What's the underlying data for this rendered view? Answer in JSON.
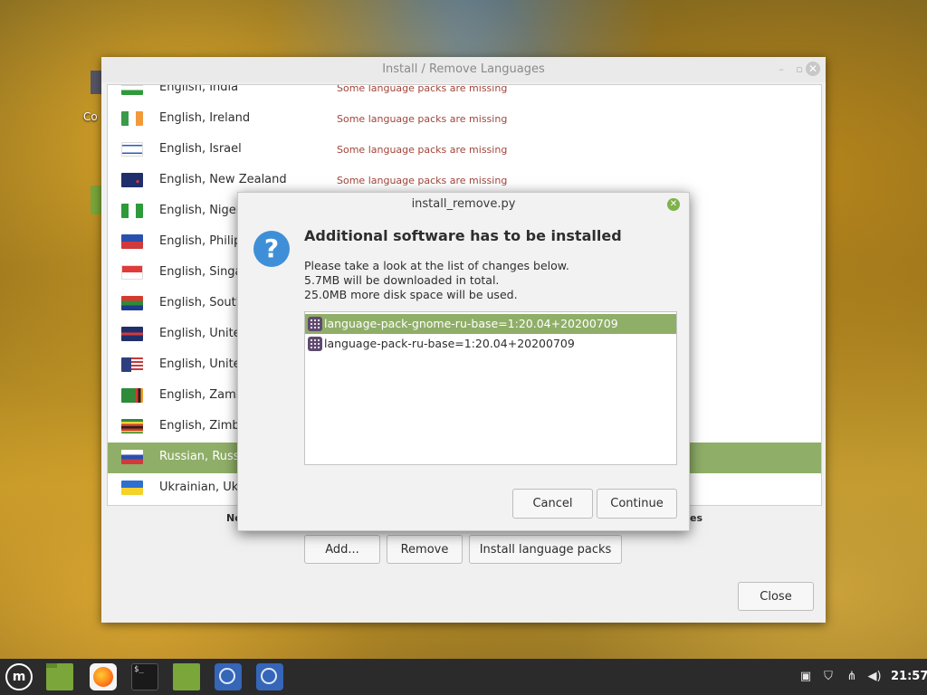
{
  "desktop": {
    "icon_label_fragment": "Co"
  },
  "main_window": {
    "title": "Install / Remove Languages",
    "languages": [
      {
        "name": "English, India",
        "status": "Some language packs are missing",
        "flag": "india-flag"
      },
      {
        "name": "English, Ireland",
        "status": "Some language packs are missing",
        "flag": "ireland-flag"
      },
      {
        "name": "English, Israel",
        "status": "Some language packs are missing",
        "flag": "israel-flag"
      },
      {
        "name": "English, New Zealand",
        "status": "Some language packs are missing",
        "flag": "new-zealand-flag"
      },
      {
        "name": "English, Nigeri",
        "status": "",
        "flag": "nigeria-flag"
      },
      {
        "name": "English, Philip",
        "status": "",
        "flag": "philippines-flag"
      },
      {
        "name": "English, Singap",
        "status": "",
        "flag": "singapore-flag"
      },
      {
        "name": "English, South",
        "status": "",
        "flag": "south-africa-flag"
      },
      {
        "name": "English, Unite",
        "status": "",
        "flag": "united-kingdom-flag"
      },
      {
        "name": "English, Unite",
        "status": "",
        "flag": "united-states-flag"
      },
      {
        "name": "English, Zamb",
        "status": "",
        "flag": "zambia-flag"
      },
      {
        "name": "English, Zimba",
        "status": "",
        "flag": "zimbabwe-flag"
      },
      {
        "name": "Russian, Russi",
        "status": "",
        "flag": "russia-flag",
        "selected": true
      },
      {
        "name": "Ukrainian, Ukr",
        "status": "",
        "flag": "ukraine-flag"
      }
    ],
    "note_left_fragment": "No",
    "note_right_fragment": "es",
    "buttons": {
      "add": "Add...",
      "remove": "Remove",
      "install": "Install language packs",
      "close": "Close"
    }
  },
  "dialog": {
    "title": "install_remove.py",
    "heading": "Additional software has to be installed",
    "lines": [
      "Please take a look at the list of changes below.",
      "5.7MB will be downloaded in total.",
      "25.0MB more disk space will be used."
    ],
    "packages": [
      {
        "name": "language-pack-gnome-ru-base=1:20.04+20200709",
        "selected": true
      },
      {
        "name": "language-pack-ru-base=1:20.04+20200709",
        "selected": false
      }
    ],
    "buttons": {
      "cancel": "Cancel",
      "continue": "Continue"
    }
  },
  "taskbar": {
    "items": [
      "mint-menu-icon",
      "files-icon",
      "firefox-icon",
      "terminal-icon",
      "folder-icon",
      "language-settings-icon",
      "language-settings-icon"
    ],
    "terminal_glyph": "$_",
    "clock": "21:57"
  },
  "colors": {
    "selection": "#8fae68",
    "status_text": "#a2453a",
    "accent_blue": "#3f8fd8"
  }
}
